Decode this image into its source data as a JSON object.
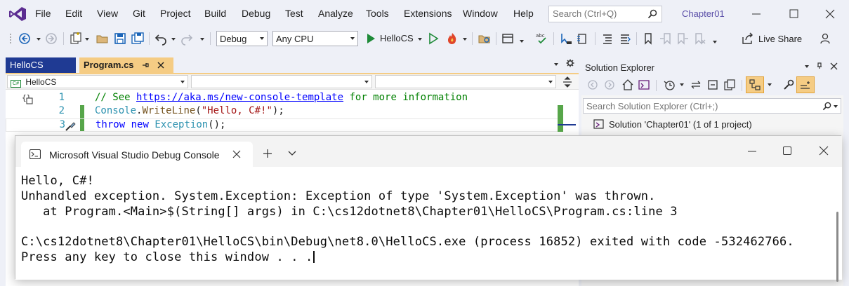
{
  "menu": {
    "items": [
      "File",
      "Edit",
      "View",
      "Git",
      "Project",
      "Build",
      "Debug",
      "Test",
      "Analyze",
      "Tools",
      "Extensions",
      "Window",
      "Help"
    ],
    "search_placeholder": "Search (Ctrl+Q)",
    "solution_name": "Chapter01"
  },
  "toolbar": {
    "config": "Debug",
    "platform": "Any CPU",
    "run_target": "HelloCS",
    "live_share": "Live Share"
  },
  "editor": {
    "tabs": [
      {
        "label": "HelloCS",
        "active": false
      },
      {
        "label": "Program.cs",
        "active": true
      }
    ],
    "nav_project": "HelloCS",
    "lines": [
      {
        "number": "1",
        "comment_prefix": "// See ",
        "link": "https://aka.ms/new-console-template",
        "comment_suffix": " for more information"
      },
      {
        "number": "2",
        "type": "Console",
        "dot": ".",
        "method": "WriteLine",
        "open": "(",
        "string": "\"Hello, C#!\"",
        "close": ");"
      },
      {
        "number": "3",
        "kw1": "throw",
        "kw2": "new",
        "type": "Exception",
        "rest": "();"
      }
    ]
  },
  "solution_explorer": {
    "title": "Solution Explorer",
    "search_placeholder": "Search Solution Explorer (Ctrl+;)",
    "solution_item": "Solution 'Chapter01' (1 of 1 project)"
  },
  "console": {
    "tab_title": "Microsoft Visual Studio Debug Console",
    "output": [
      "Hello, C#!",
      "Unhandled exception. System.Exception: Exception of type 'System.Exception' was thrown.",
      "   at Program.<Main>$(String[] args) in C:\\cs12dotnet8\\Chapter01\\HelloCS\\Program.cs:line 3",
      "",
      "C:\\cs12dotnet8\\Chapter01\\HelloCS\\bin\\Debug\\net8.0\\HelloCS.exe (process 16852) exited with code -532462766.",
      "Press any key to close this window . . ."
    ]
  },
  "colors": {
    "accent": "#68217a",
    "active_tab": "#f5cc84",
    "inactive_tab": "#1f3a93",
    "run_green": "#1e8a38"
  }
}
